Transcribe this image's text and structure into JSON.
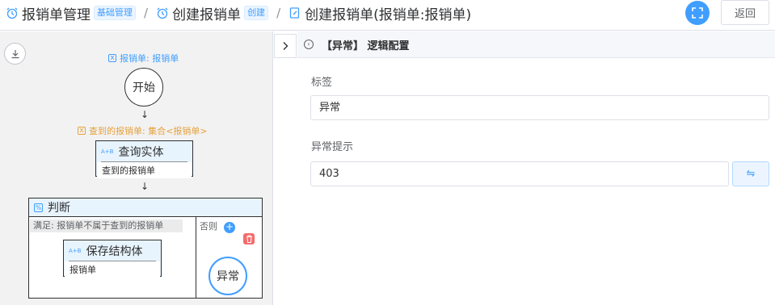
{
  "breadcrumb": [
    {
      "label": "报销单管理",
      "tag": "基础管理",
      "icon": "alarm-clock-icon"
    },
    {
      "label": "创建报销单",
      "tag": "创建",
      "icon": "alarm-clock-icon"
    },
    {
      "label": "创建报销单(报销单:报销单)",
      "icon": "edit-document-icon"
    }
  ],
  "separator": "/",
  "header": {
    "back_label": "返回"
  },
  "flow": {
    "input_var": "报销单: 报销单",
    "start_label": "开始",
    "query_var": "查到的报销单: 集合<报销单>",
    "query_node": {
      "badge": "A+B",
      "title": "查询实体",
      "sub": "查到的报销单"
    },
    "judge": {
      "icon": "%",
      "title": "判断",
      "condition": "满足:  报销单不属于查到的报销单",
      "else_label": "否则",
      "save_node": {
        "badge": "A+B",
        "title": "保存结构体",
        "sub": "报销单"
      },
      "exception_label": "异常"
    }
  },
  "panel": {
    "title": "【异常】 逻辑配置",
    "label_field": {
      "label": "标签",
      "value": "异常"
    },
    "message_field": {
      "label": "异常提示",
      "value": "403"
    },
    "swap_glyph": "⇋"
  },
  "colors": {
    "accent": "#409eff",
    "danger": "#f56c6c",
    "warning": "#e6a23c"
  }
}
